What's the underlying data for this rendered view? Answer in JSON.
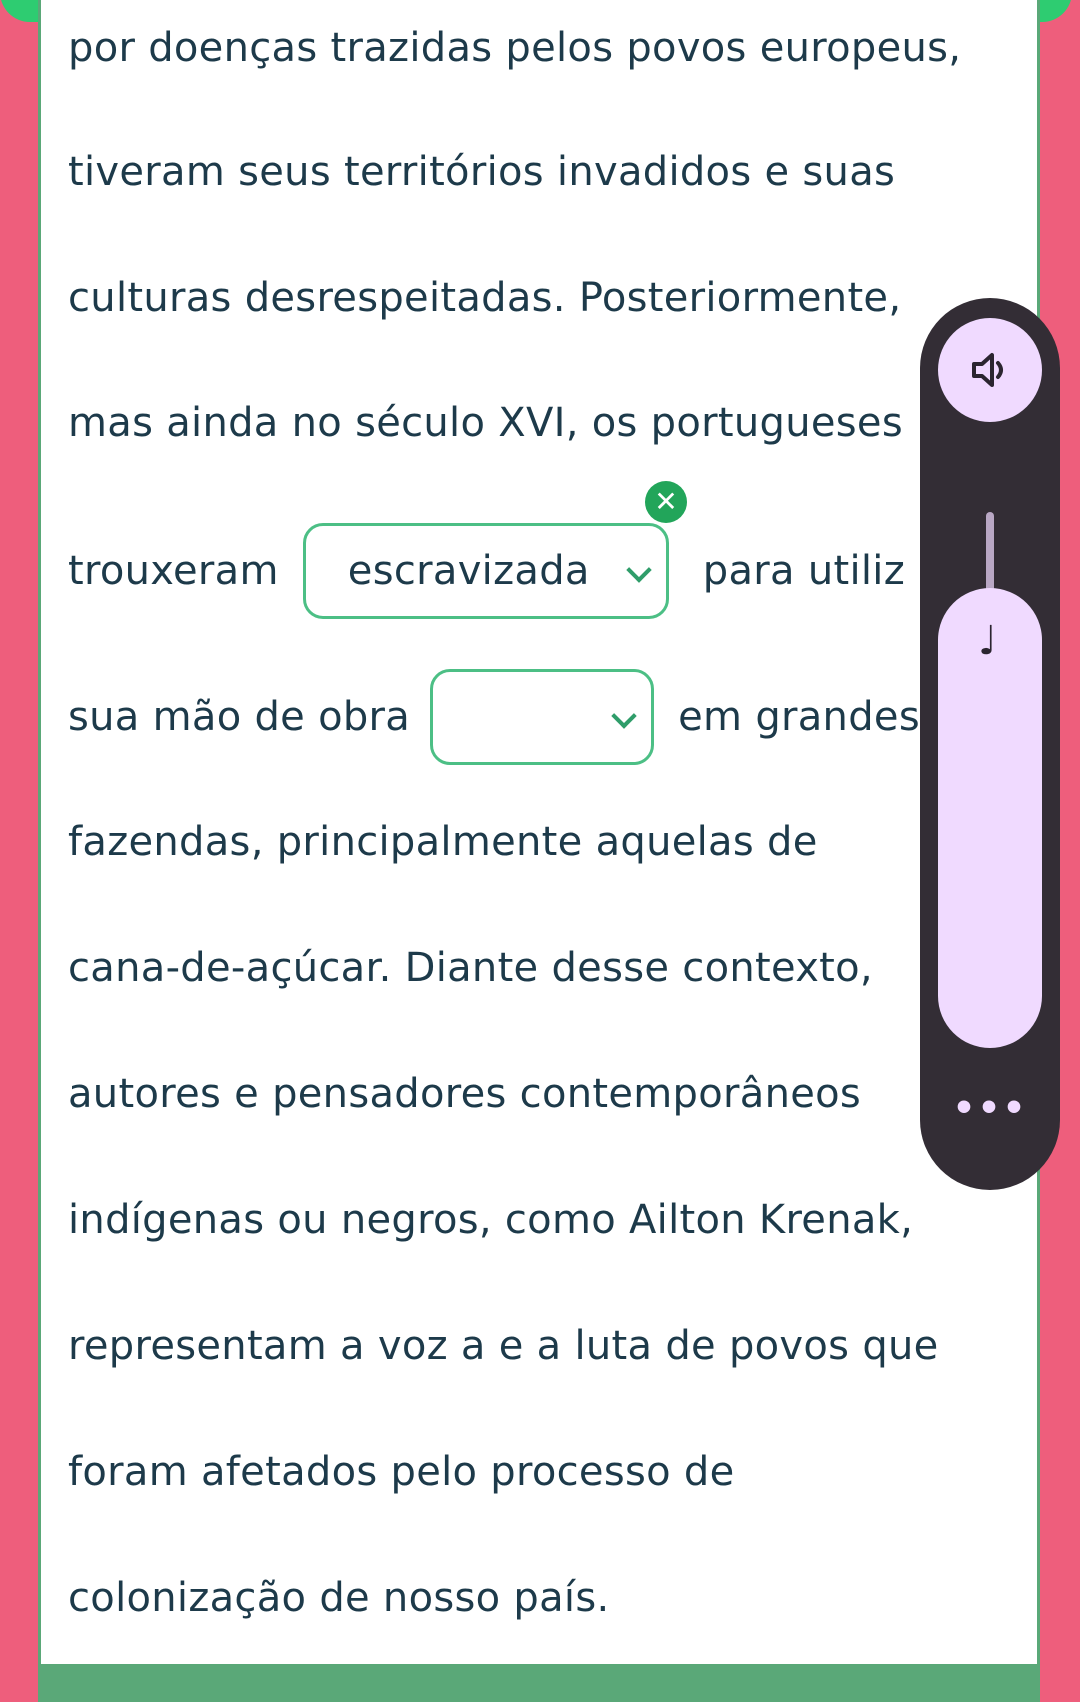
{
  "passage": {
    "line1": "por doenças trazidas pelos povos europeus,",
    "line2": "tiveram seus territórios invadidos e suas",
    "line3": "culturas desrespeitadas. Posteriormente,",
    "line4": "mas ainda no século XVI, os portugueses",
    "line5_before": "trouxeram",
    "line5_after": "para utiliz",
    "line6_before": "sua mão de obra",
    "line6_after": "em grandes",
    "line7": "fazendas, principalmente aquelas de",
    "line8": "cana-de-açúcar. Diante desse contexto,",
    "line9": "autores e pensadores contemporâneos",
    "line10": "indígenas ou negros, como Ailton Krenak,",
    "line11": "representam a voz a e a luta de povos que",
    "line12": "foram afetados pelo processo de",
    "line13": "colonização de nosso país."
  },
  "blanks": {
    "blank1": {
      "selected": "escravizada",
      "clear_icon": "✕"
    },
    "blank2": {
      "selected": ""
    }
  },
  "volume_overlay": {
    "speaker_icon": "speaker-icon",
    "note_icon": "♩",
    "more": "•••"
  },
  "colors": {
    "page_bg": "#ee5e7c",
    "top_bar": "#2ecc71",
    "text": "#1d3a4a",
    "select_border": "#4cbf85",
    "overlay_bg": "#332d35",
    "overlay_accent": "#f0daff"
  }
}
